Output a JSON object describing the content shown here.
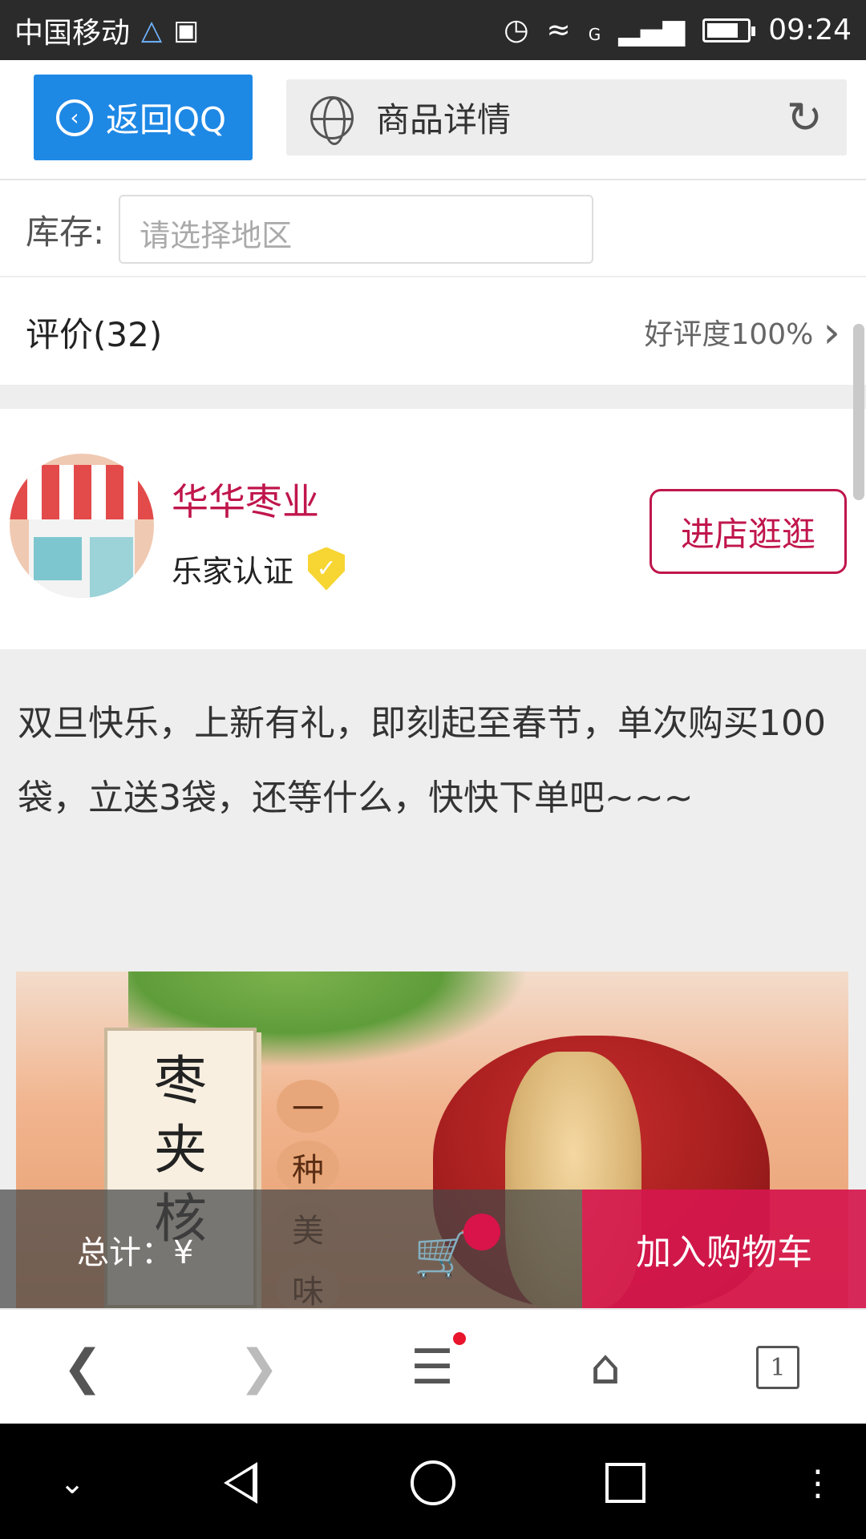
{
  "status_bar": {
    "carrier": "中国移动",
    "time": "09:24",
    "network_type": "G",
    "icons": [
      "qq-notify-icon",
      "image-icon",
      "alarm-icon",
      "wifi-icon",
      "signal-icon",
      "battery-icon"
    ]
  },
  "browser_top": {
    "back_label": "返回QQ",
    "page_title": "商品详情",
    "accent": "#1e88e5"
  },
  "stock": {
    "label": "库存:",
    "placeholder": "请选择地区"
  },
  "reviews": {
    "title": "评价(32)",
    "rating": "好评度100%"
  },
  "shop": {
    "name": "华华枣业",
    "certification": "乐家认证",
    "visit_button": "进店逛逛",
    "accent": "#c0164c"
  },
  "description": {
    "text": "双旦快乐，上新有礼，即刻起至春节，单次购买100袋，立送3袋，还等什么，快快下单吧~~~"
  },
  "product_image": {
    "card_text": [
      "枣",
      "夹",
      "核"
    ],
    "seal_text": [
      "一",
      "种",
      "美",
      "味"
    ]
  },
  "buy_bar": {
    "total_label": "总计：¥",
    "add_to_cart": "加入购物车",
    "accent": "#d5174d"
  },
  "browser_nav": {
    "tab_count": "1"
  }
}
